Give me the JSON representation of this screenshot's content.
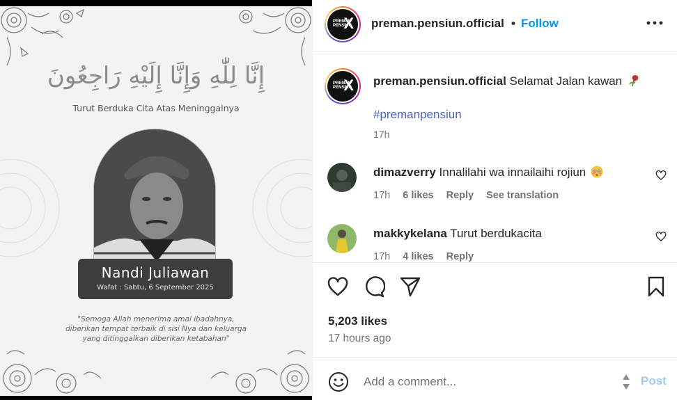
{
  "post_image": {
    "arabic_text": "إِنَّا لِلّٰهِ وَإِنَّا إِلَيْهِ رَاجِعُونَ",
    "condolence": "Turut Berduka Cita Atas Meninggalnya",
    "name": "Nandi Juliawan",
    "date": "Wafat : Sabtu, 6 September 2025",
    "prayer_line1": "\"Semoga Allah menerima amal ibadahnya,",
    "prayer_line2": "diberikan tempat terbaik di sisi Nya dan keluarga",
    "prayer_line3": "yang ditinggalkan diberikan ketabahan\""
  },
  "header": {
    "username": "preman.pensiun.official",
    "separator": "•",
    "follow_label": "Follow",
    "logo_text": "PREMAN PENSIUN"
  },
  "caption": {
    "username": "preman.pensiun.official",
    "text": "Selamat Jalan kawan",
    "hashtag": "#premanpensiun",
    "time": "17h"
  },
  "comments": [
    {
      "username": "dimazverry",
      "text": "Innalilahi wa innailaihi rojiun",
      "time": "17h",
      "likes": "6 likes",
      "reply": "Reply",
      "translate": "See translation"
    },
    {
      "username": "makkykelana",
      "text": "Turut berdukacita",
      "time": "17h",
      "likes": "4 likes",
      "reply": "Reply"
    }
  ],
  "actions": {
    "likes": "5,203 likes",
    "time_ago": "17 hours ago"
  },
  "add_comment": {
    "placeholder": "Add a comment...",
    "post_label": "Post"
  },
  "colors": {
    "follow": "#0095f6",
    "hashtag": "#4a5fc7",
    "post_disabled": "#a1c8f5",
    "muted": "#737373"
  }
}
